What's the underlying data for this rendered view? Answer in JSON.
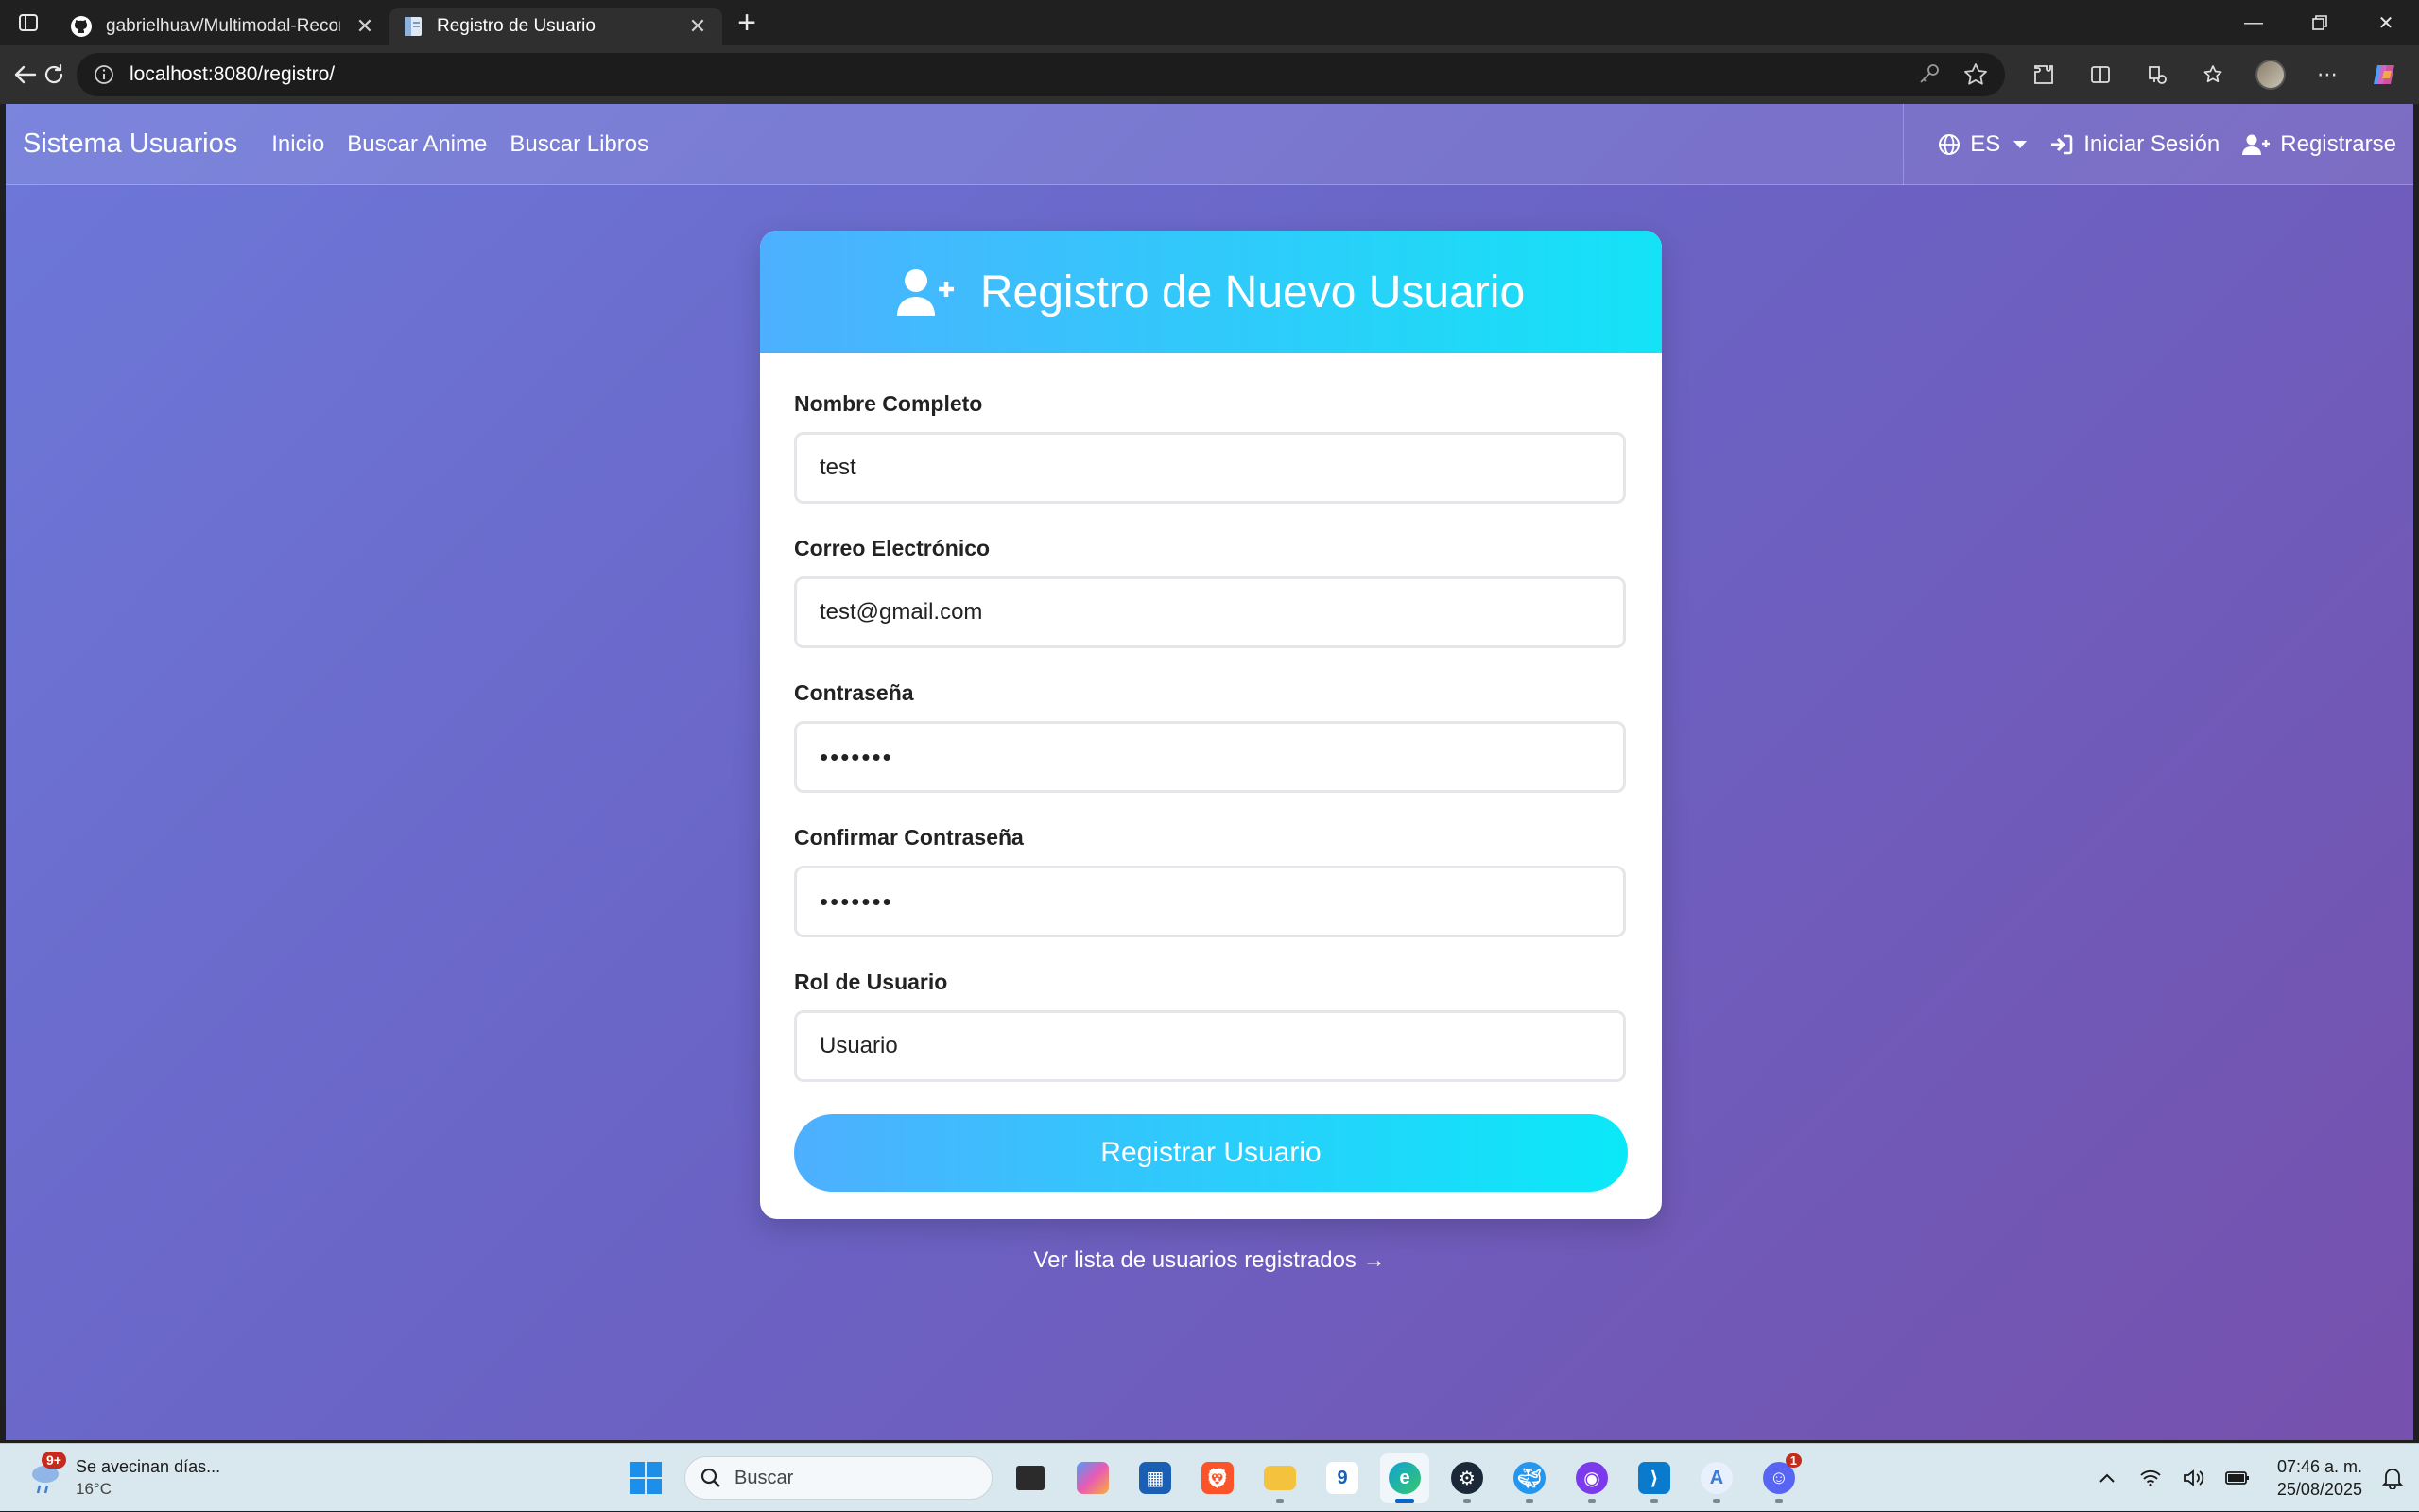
{
  "browser": {
    "tabs": [
      {
        "title": "gabrielhuav/Multimodal-Recomm",
        "icon": "github-icon",
        "active": false
      },
      {
        "title": "Registro de Usuario",
        "icon": "page-icon",
        "active": true
      }
    ],
    "url": "localhost:8080/registro/"
  },
  "navbar": {
    "brand": "Sistema Usuarios",
    "links": [
      "Inicio",
      "Buscar Anime",
      "Buscar Libros"
    ],
    "language": "ES",
    "login": "Iniciar Sesión",
    "register": "Registrarse"
  },
  "form": {
    "title": "Registro de Nuevo Usuario",
    "fields": [
      {
        "label": "Nombre Completo",
        "value": "test",
        "type": "text"
      },
      {
        "label": "Correo Electrónico",
        "value": "test@gmail.com",
        "type": "email"
      },
      {
        "label": "Contraseña",
        "value": "•••••••",
        "type": "password"
      },
      {
        "label": "Confirmar Contraseña",
        "value": "•••••••",
        "type": "password"
      },
      {
        "label": "Rol de Usuario",
        "value": "Usuario",
        "type": "select"
      }
    ],
    "submit": "Registrar Usuario",
    "list_link": "Ver lista de usuarios registrados →"
  },
  "taskbar": {
    "weather_text": "Se avecinan días...",
    "weather_temp": "16°C",
    "weather_badge": "9+",
    "search_placeholder": "Buscar",
    "discord_badge": "1",
    "time": "07:46 a. m.",
    "date": "25/08/2025"
  },
  "colors": {
    "header_gradient_start": "#4db0ff",
    "header_gradient_end": "#14e3f6",
    "page_gradient_start": "#6d78d8",
    "page_gradient_end": "#7651ad"
  }
}
